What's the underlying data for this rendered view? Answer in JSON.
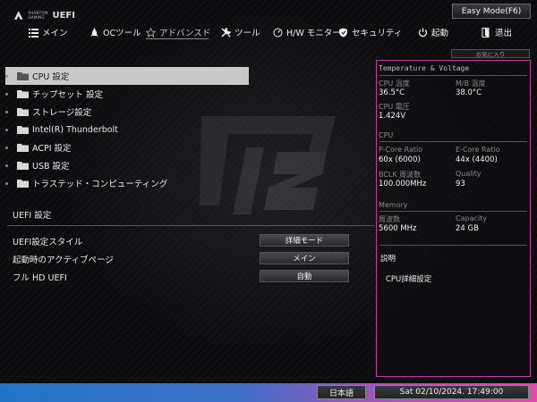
{
  "brand": {
    "small_text": "PHANTOM GAMING",
    "uefi_text": "UEFI"
  },
  "header": {
    "easy_mode_label": "Easy Mode(F6)",
    "tabs": [
      {
        "label": "メイン",
        "icon": "list-icon"
      },
      {
        "label": "OCツール",
        "icon": "rocket-icon"
      },
      {
        "label": "アドバンスド",
        "icon": "star-icon"
      },
      {
        "label": "ツール",
        "icon": "tools-icon"
      },
      {
        "label": "H/W モニター",
        "icon": "monitor-icon"
      },
      {
        "label": "セキュリティ",
        "icon": "shield-icon"
      },
      {
        "label": "起動",
        "icon": "power-icon"
      },
      {
        "label": "退出",
        "icon": "exit-icon"
      }
    ],
    "active_tab": "アドバンスド",
    "favorites_label": "お気に入り"
  },
  "menu": {
    "items": [
      {
        "label": "CPU 設定"
      },
      {
        "label": "チップセット 設定"
      },
      {
        "label": "ストレージ設定"
      },
      {
        "label": "Intel(R) Thunderbolt"
      },
      {
        "label": "ACPI 設定"
      },
      {
        "label": "USB 設定"
      },
      {
        "label": "トラステッド・コンピューティング"
      }
    ],
    "selected_index": 0
  },
  "uefi_settings": {
    "title": "UEFI 設定",
    "options": [
      {
        "label": "UEFI設定スタイル",
        "value": "詳細モード"
      },
      {
        "label": "起動時のアクティブページ",
        "value": "メイン"
      },
      {
        "label": "フル HD UEFI",
        "value": "自動"
      }
    ]
  },
  "panel": {
    "tv_title": "Temperature & Voltage",
    "cpu_temp_label": "CPU 温度",
    "cpu_temp_value": "36.5°C",
    "mb_temp_label": "M/B 温度",
    "mb_temp_value": "38.0°C",
    "cpu_voltage_label": "CPU 電圧",
    "cpu_voltage_value": "1.424V",
    "cpu_title": "CPU",
    "pcore_label": "P-Core Ratio",
    "pcore_value": "60x (6000)",
    "ecore_label": "E-Core Ratio",
    "ecore_value": "44x (4400)",
    "bclk_label": "BCLK 周波数",
    "bclk_value": "100.000MHz",
    "quality_label": "Quality",
    "quality_value": "93",
    "memory_title": "Memory",
    "mem_freq_label": "周波数",
    "mem_freq_value": "5600 MHz",
    "capacity_label": "Capacity",
    "capacity_value": "24 GB",
    "description_title": "説明",
    "description_text": "CPU詳細設定"
  },
  "footer": {
    "language": "日本語",
    "datetime": "Sat 02/10/2024. 17:49:00"
  },
  "colors": {
    "panel_border": "#c23c9b",
    "selected_bg": "#c9c9c9",
    "footer_left": "#1f74c7",
    "footer_right": "#e04ca8"
  }
}
